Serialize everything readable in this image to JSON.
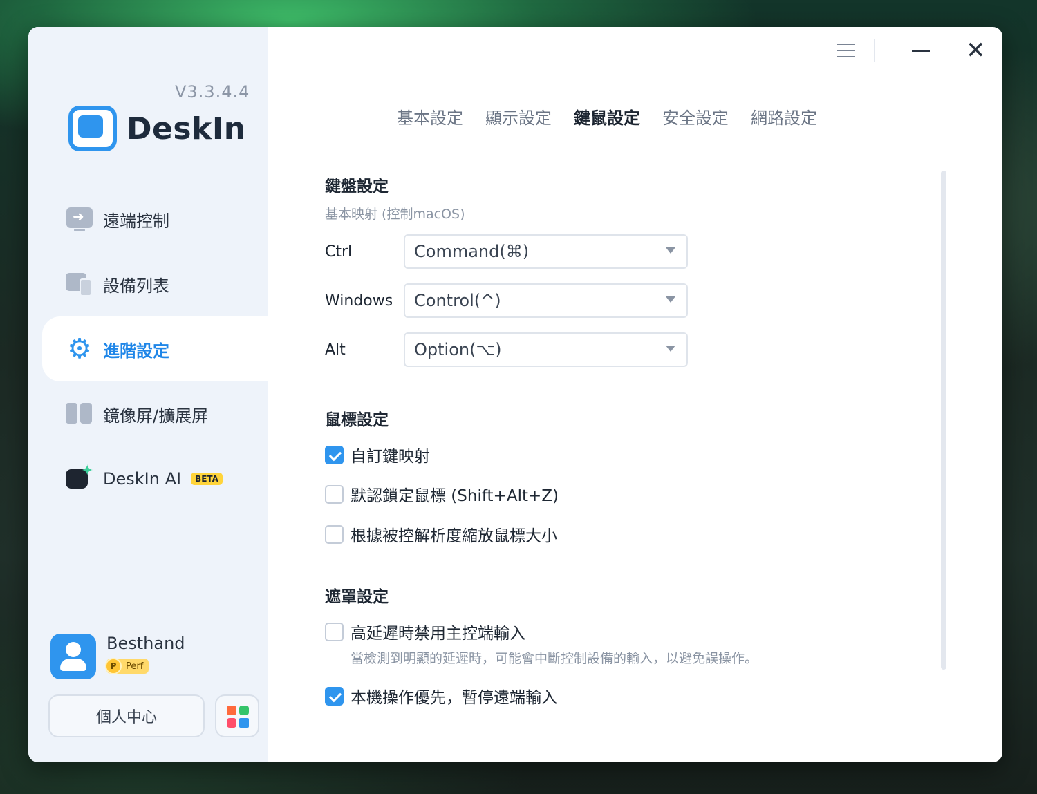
{
  "app": {
    "version": "V3.3.4.4",
    "name": "DeskIn",
    "accent_color": "#2f95ee"
  },
  "window_controls": {
    "menu_icon": "hamburger-menu-icon",
    "minimize_icon": "minimize-icon",
    "close_icon": "close-icon",
    "close_glyph": "✕"
  },
  "sidebar": {
    "items": [
      {
        "label": "遠端控制",
        "icon": "remote-control-icon"
      },
      {
        "label": "設備列表",
        "icon": "device-list-icon"
      },
      {
        "label": "進階設定",
        "icon": "gear-icon",
        "active": true
      },
      {
        "label": "鏡像屏/擴展屏",
        "icon": "mirror-screen-icon"
      },
      {
        "label": "DeskIn AI",
        "icon": "deskin-ai-icon",
        "badge": "BETA"
      }
    ],
    "gear_glyph": "⚙",
    "user": {
      "name": "Besthand",
      "badge_letter": "P",
      "badge_label": "Perf"
    },
    "profile_button": "個人中心"
  },
  "tabs": [
    {
      "label": "基本設定"
    },
    {
      "label": "顯示設定"
    },
    {
      "label": "鍵鼠設定",
      "active": true
    },
    {
      "label": "安全設定"
    },
    {
      "label": "網路設定"
    }
  ],
  "keyboard": {
    "title": "鍵盤設定",
    "subtitle": "基本映射 (控制macOS)",
    "mappings": [
      {
        "key": "Ctrl",
        "value": "Command(⌘)"
      },
      {
        "key": "Windows",
        "value": "Control(^)"
      },
      {
        "key": "Alt",
        "value": "Option(⌥)"
      }
    ]
  },
  "mouse": {
    "title": "鼠標設定",
    "options": [
      {
        "label": "自訂鍵映射",
        "checked": true
      },
      {
        "label": "默認鎖定鼠標 (Shift+Alt+Z)",
        "checked": false
      },
      {
        "label": "根據被控解析度縮放鼠標大小",
        "checked": false
      }
    ]
  },
  "mask": {
    "title": "遮罩設定",
    "options": [
      {
        "label": "高延遲時禁用主控端輸入",
        "checked": false,
        "description": "當檢測到明顯的延遲時，可能會中斷控制設備的輸入，以避免誤操作。"
      },
      {
        "label": "本機操作優先，暫停遠端輸入",
        "checked": true
      }
    ]
  }
}
